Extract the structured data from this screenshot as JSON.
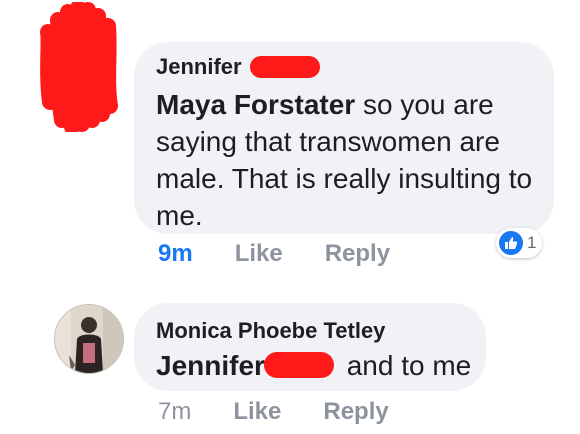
{
  "comment1": {
    "author": "Jennifer",
    "mention": "Maya Forstater",
    "text": " so you are saying that transwomen are male. That is really insulting to me.",
    "timestamp": "9m",
    "like_label": "Like",
    "reply_label": "Reply",
    "reaction_count": "1"
  },
  "comment2": {
    "author": "Monica Phoebe Tetley",
    "mention": "Jennifer",
    "text": "and to me",
    "timestamp": "7m",
    "like_label": "Like",
    "reply_label": "Reply"
  },
  "colors": {
    "bubble_bg": "#f0f2f5",
    "accent_blue": "#1877f2",
    "meta_grey": "#8d949e",
    "redaction_red": "#ff1a1a"
  },
  "icons": [
    "like-icon",
    "avatar"
  ]
}
